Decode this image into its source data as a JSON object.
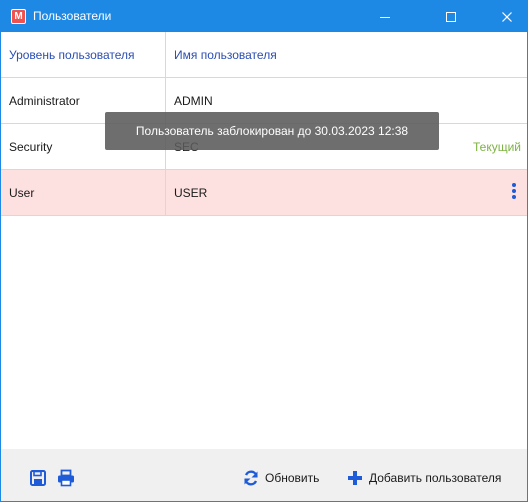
{
  "window": {
    "title": "Пользователи",
    "app_icon_glyph": "М",
    "accent_color": "#1e88e5"
  },
  "table": {
    "headers": [
      "Уровень пользователя",
      "Имя пользователя"
    ],
    "rows": [
      {
        "level": "Administrator",
        "name": "ADMIN",
        "badge": ""
      },
      {
        "level": "Security",
        "name": "SEC",
        "badge": "Текущий"
      },
      {
        "level": "User",
        "name": "USER",
        "badge": ""
      }
    ],
    "selected_row_color": "#fde0e0",
    "badge_color": "#7cb342"
  },
  "tooltip": {
    "text": "Пользователь заблокирован до 30.03.2023 12:38"
  },
  "footer": {
    "icons": [
      "save-icon",
      "print-icon"
    ],
    "refresh_label": "Обновить",
    "add_user_label": "Добавить пользователя"
  }
}
